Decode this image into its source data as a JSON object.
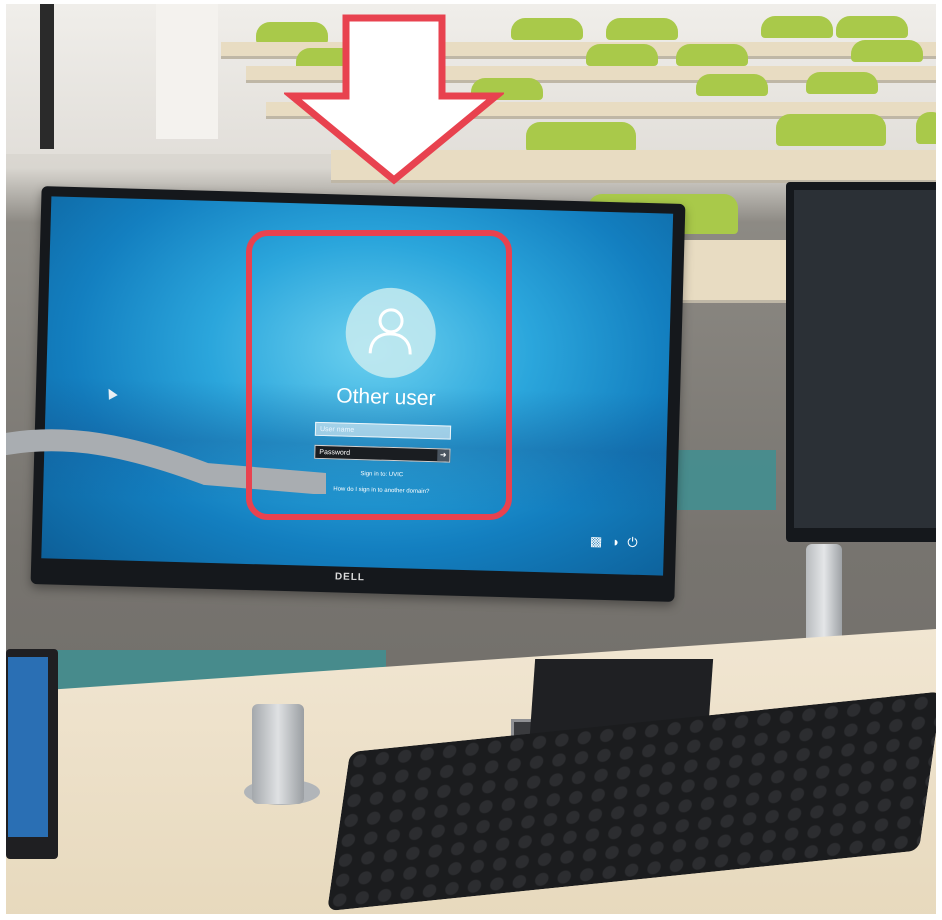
{
  "login_screen": {
    "username": "Other user",
    "username_placeholder": "User name",
    "password_placeholder": "Password",
    "sign_in_to": "Sign in to: UVIC",
    "other_domain_link": "How do I sign in to another domain?"
  },
  "monitor_brand": "DELL",
  "annotation": {
    "highlight_color": "#e8424f",
    "arrow_color": "#e8424f"
  },
  "icons": [
    "user-icon",
    "accessibility-icon",
    "network-icon",
    "power-icon",
    "mouse-cursor-icon"
  ]
}
